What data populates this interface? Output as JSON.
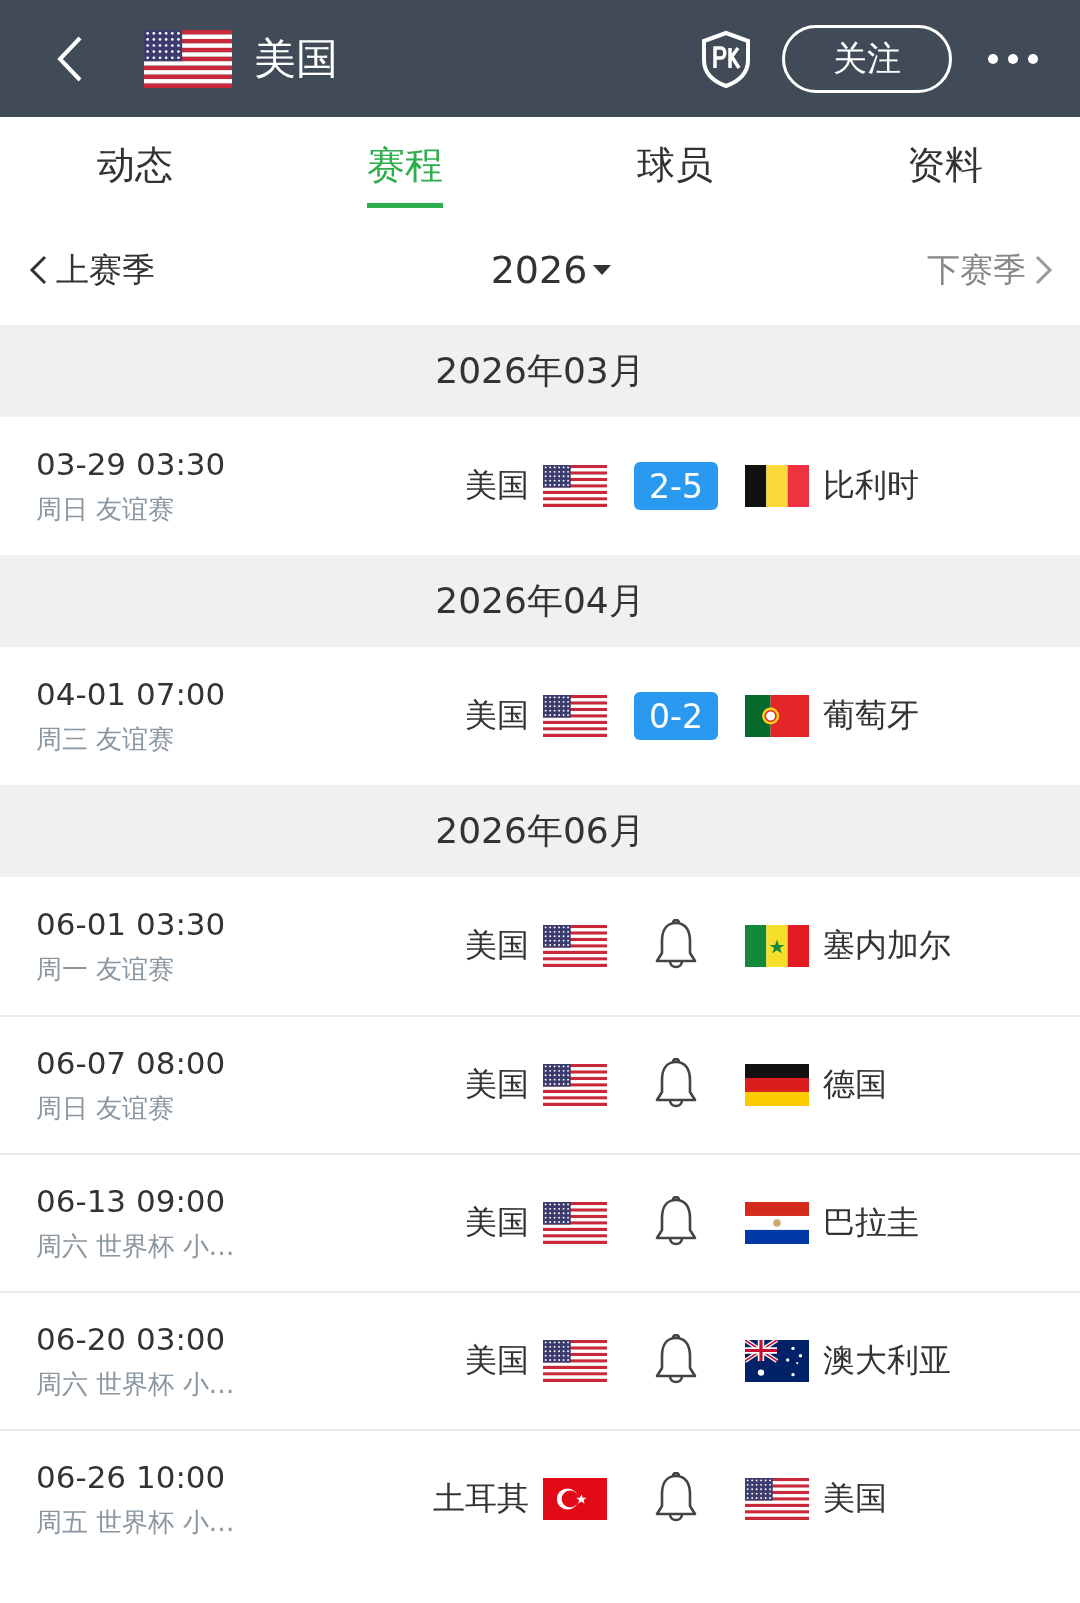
{
  "header": {
    "title": "美国",
    "flag": {
      "kind": "us"
    },
    "follow_button": "关注"
  },
  "tabs": [
    {
      "label": "动态",
      "selected": false
    },
    {
      "label": "赛程",
      "selected": true
    },
    {
      "label": "球员",
      "selected": false
    },
    {
      "label": "资料",
      "selected": false
    }
  ],
  "season": {
    "prev": "上赛季",
    "year": "2026",
    "next": "下赛季"
  },
  "months": [
    {
      "label": "2026年03月",
      "matches": [
        {
          "kind": "finished",
          "datetime": "03-29 03:30",
          "info": "周日 友谊赛",
          "home": {
            "name": "美国",
            "flag": {
              "kind": "us"
            }
          },
          "score": "2-5",
          "away": {
            "name": "比利时",
            "flag": {
              "kind": "be"
            }
          }
        }
      ]
    },
    {
      "label": "2026年04月",
      "matches": [
        {
          "kind": "finished",
          "datetime": "04-01 07:00",
          "info": "周三 友谊赛",
          "home": {
            "name": "美国",
            "flag": {
              "kind": "us"
            }
          },
          "score": "0-2",
          "away": {
            "name": "葡萄牙",
            "flag": {
              "kind": "pt"
            }
          }
        }
      ]
    },
    {
      "label": "2026年06月",
      "matches": [
        {
          "kind": "upcoming",
          "datetime": "06-01 03:30",
          "info": "周一 友谊赛",
          "home": {
            "name": "美国",
            "flag": {
              "kind": "us"
            }
          },
          "away": {
            "name": "塞内加尔",
            "flag": {
              "kind": "sn"
            }
          }
        },
        {
          "kind": "upcoming",
          "datetime": "06-07 08:00",
          "info": "周日 友谊赛",
          "home": {
            "name": "美国",
            "flag": {
              "kind": "us"
            }
          },
          "away": {
            "name": "德国",
            "flag": {
              "kind": "de"
            }
          }
        },
        {
          "kind": "upcoming",
          "datetime": "06-13 09:00",
          "info": "周六 世界杯 小…",
          "home": {
            "name": "美国",
            "flag": {
              "kind": "us"
            }
          },
          "away": {
            "name": "巴拉圭",
            "flag": {
              "kind": "py"
            }
          }
        },
        {
          "kind": "upcoming",
          "datetime": "06-20 03:00",
          "info": "周六 世界杯 小…",
          "home": {
            "name": "美国",
            "flag": {
              "kind": "us"
            }
          },
          "away": {
            "name": "澳大利亚",
            "flag": {
              "kind": "au"
            }
          }
        },
        {
          "kind": "upcoming",
          "datetime": "06-26 10:00",
          "info": "周五 世界杯 小…",
          "home": {
            "name": "土耳其",
            "flag": {
              "kind": "tr"
            }
          },
          "away": {
            "name": "美国",
            "flag": {
              "kind": "us"
            }
          }
        }
      ]
    }
  ]
}
